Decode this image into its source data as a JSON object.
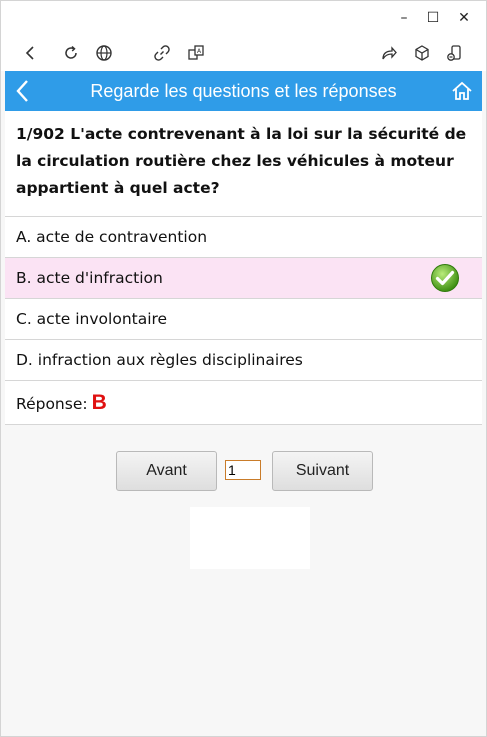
{
  "window": {
    "minimize": "–",
    "maximize": "☐",
    "close": "✕"
  },
  "toolbar": {
    "icons": [
      "back-icon",
      "refresh-icon",
      "globe-icon",
      "link-icon",
      "translate-icon",
      "share-icon",
      "cube-icon",
      "device-icon"
    ]
  },
  "header": {
    "title": "Regarde les questions et les réponses",
    "bg_color": "#2f9ce8"
  },
  "question": {
    "text": "1/902 L'acte contrevenant à la loi sur la sécurité de la circulation routière chez les véhicules à moteur appartient à quel acte?"
  },
  "options": [
    {
      "label": "A. acte de contravention",
      "selected": false
    },
    {
      "label": "B. acte d'infraction",
      "selected": true
    },
    {
      "label": "C. acte involontaire",
      "selected": false
    },
    {
      "label": "D. infraction aux règles disciplinaires",
      "selected": false
    }
  ],
  "answer": {
    "label": "Réponse:",
    "value": "B",
    "color": "#e01010"
  },
  "nav": {
    "prev_label": "Avant",
    "next_label": "Suivant",
    "page_value": "1"
  }
}
